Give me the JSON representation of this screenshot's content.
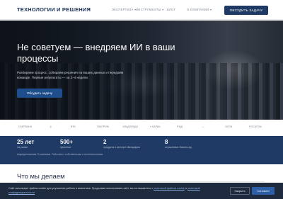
{
  "header": {
    "logo": "ТЕХНОЛОГИИ И РЕШЕНИЯ",
    "nav": [
      "ЭКСПЕРТИЗА ▾",
      "ИНСТРУМЕНТЫ ▾",
      "БЛОГ",
      "О КОМПАНИИ ▾"
    ],
    "cta": "ОБСУДИТЬ ЗАДАЧУ"
  },
  "hero": {
    "title": "Не советуем — внедряем ИИ в ваши процессы",
    "text": "Разбираем процесс, собираем решения на ваших данных и передаём команде. Первые результаты — за 2–4 недели.",
    "button": "Обсудить задачу"
  },
  "logos": [
    "СБЕРБАНК",
    "◎",
    "ВТБ",
    "ГАЗПРОМ",
    "ЭЛЬДОРАДО",
    "≡ БАРАБ",
    "РЖД",
    "—",
    "OZON",
    "РОСАТОМ"
  ],
  "stats": {
    "items": [
      {
        "n": "25 лет",
        "l": "на рынке"
      },
      {
        "n": "500+",
        "l": "проектов"
      },
      {
        "n": "2",
        "l": "продукта в реестре Минцифры"
      },
      {
        "n": "8",
        "l": "отраслевых бизнес-ед."
      }
    ],
    "note": "Аккредитованная IT-компания. Работаем с собственными и гостехнологиями."
  },
  "section": {
    "title": "Что мы делаем"
  },
  "cookie": {
    "text": "Сайт использует файлы cookie для улучшения работы и аналитики. Продолжая использовать сайт, вы соглашаетесь с ",
    "link1": "политикой файлов cookie",
    "and": " и ",
    "link2": "политикой конфиденциальности",
    "close": "Закрыть",
    "accept": "Согласен"
  }
}
